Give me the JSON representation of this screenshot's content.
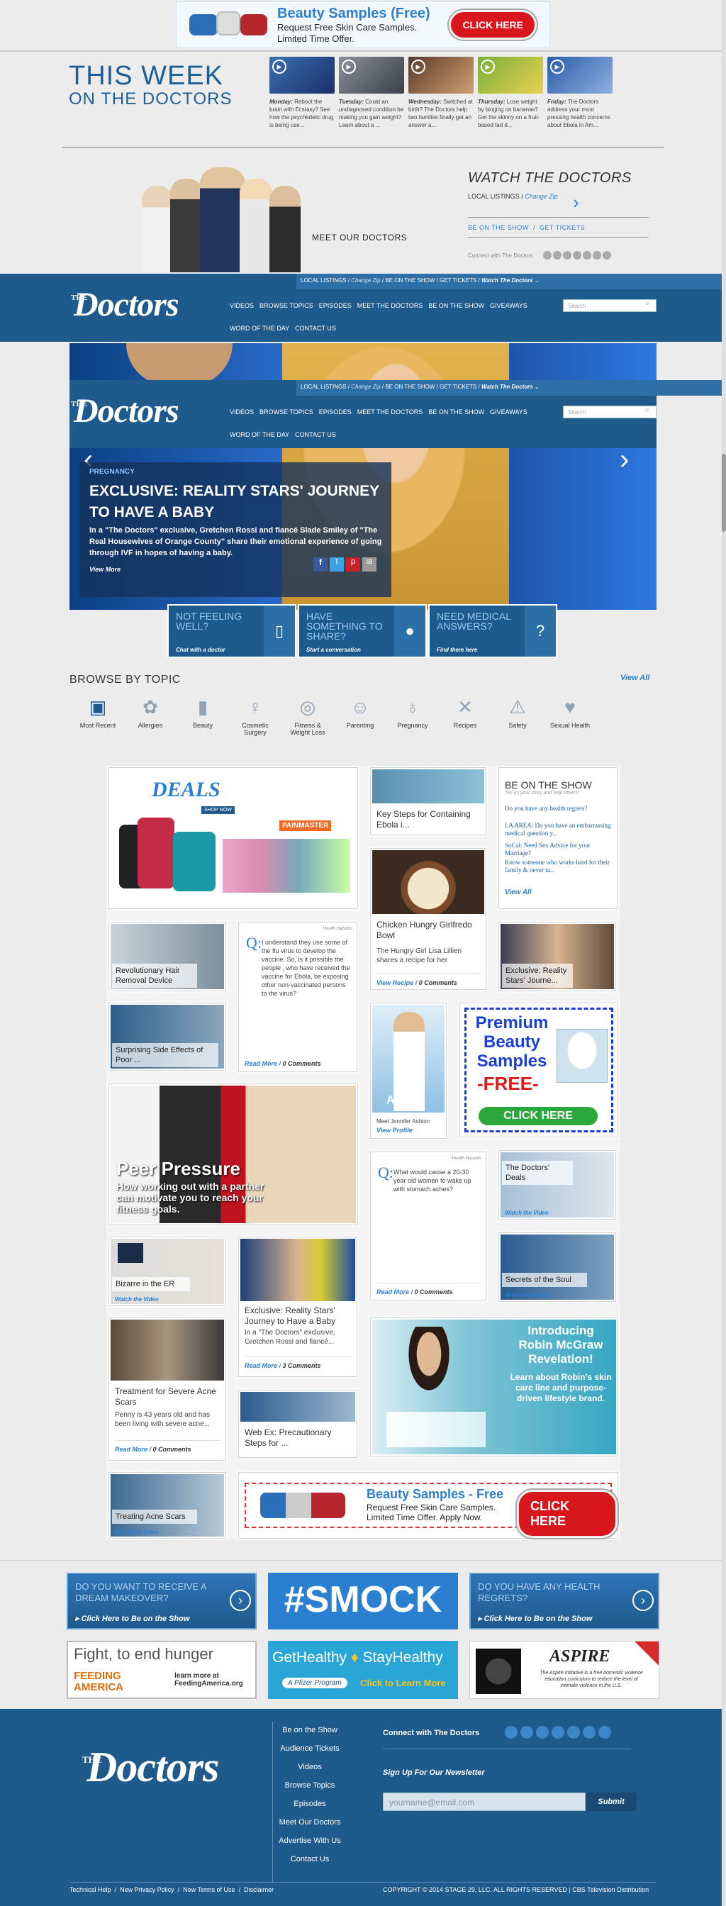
{
  "top_ad": {
    "title": "Beauty Samples (Free)",
    "line1": "Request Free Skin Care Samples.",
    "line2": "Limited Time Offer.",
    "button": "CLICK HERE"
  },
  "this_week": {
    "title_line1": "THIS WEEK",
    "title_line2": "ON THE DOCTORS",
    "episodes": [
      {
        "day": "Monday:",
        "desc": "Reboot the brain with Ecstasy? See how the psychedelic drug is being use..."
      },
      {
        "day": "Tuesday:",
        "desc": "Could an undiagnosed condition be making you gain weight? Learn about a ..."
      },
      {
        "day": "Wednesday:",
        "desc": "Switched at birth? The Doctors help two families finally get an answer a..."
      },
      {
        "day": "Thursday:",
        "desc": "Lose weight by binging on bananas? Get the skinny on a fruit-based fad d..."
      },
      {
        "day": "Friday:",
        "desc": "The Doctors address your most pressing health concerns about Ebola in Am..."
      }
    ]
  },
  "hosts": {
    "meet_label": "MEET OUR DOCTORS"
  },
  "watch": {
    "title": "WATCH THE DOCTORS",
    "local_listings": "LOCAL LISTINGS /",
    "change_zip": "Change Zip",
    "be_on_show": "BE ON THE SHOW",
    "separator": "/",
    "get_tickets": "GET TICKETS",
    "connect": "Connect with The Doctors"
  },
  "nav": {
    "logo_the": "THE",
    "logo_name": "Doctors",
    "local": "LOCAL LISTINGS",
    "change_zip": "Change Zip",
    "be_on": "BE ON THE SHOW",
    "tickets": "GET TICKETS",
    "watch": "Watch The Doctors",
    "links": [
      "VIDEOS",
      "BROWSE TOPICS",
      "EPISODES",
      "MEET THE DOCTORS",
      "BE ON THE SHOW",
      "GIVEAWAYS"
    ],
    "links2": [
      "WORD OF THE DAY",
      "CONTACT US"
    ],
    "search_placeholder": "Search"
  },
  "hero": {
    "tag": "PREGNANCY",
    "title": "EXCLUSIVE: REALITY STARS' JOURNEY TO HAVE A BABY",
    "desc": "In a \"The Doctors\" exclusive, Gretchen Rossi and fiancé Slade Smiley of \"The Real Housewives of Orange County\" share their emotional experience of going through IVF in hopes of having a baby.",
    "more": "View More"
  },
  "pills": [
    {
      "h": "NOT FEELING WELL?",
      "s": "Chat with a doctor"
    },
    {
      "h": "HAVE SOMETHING TO SHARE?",
      "s": "Start a conversation"
    },
    {
      "h": "NEED MEDICAL ANSWERS?",
      "s": "Find them here"
    }
  ],
  "browse": {
    "title": "BROWSE BY TOPIC",
    "view_all": "View All",
    "topics": [
      {
        "l1": "Most Recent",
        "l2": "",
        "icon": "▣"
      },
      {
        "l1": "Allergies",
        "l2": "",
        "icon": "✿"
      },
      {
        "l1": "Beauty",
        "l2": "",
        "icon": "▮"
      },
      {
        "l1": "Cosmetic",
        "l2": "Surgery",
        "icon": "♀"
      },
      {
        "l1": "Fitness &",
        "l2": "Weight Loss",
        "icon": "◎"
      },
      {
        "l1": "Parenting",
        "l2": "",
        "icon": "☺"
      },
      {
        "l1": "Pregnancy",
        "l2": "",
        "icon": "♁"
      },
      {
        "l1": "Recipes",
        "l2": "",
        "icon": "✕"
      },
      {
        "l1": "Safety",
        "l2": "",
        "icon": "⚠"
      },
      {
        "l1": "Sexual Health",
        "l2": "",
        "icon": "♥"
      }
    ]
  },
  "cards": {
    "deals_title": "DEALS",
    "deals_shop": "SHOP NOW",
    "painmaster": "PAINMASTER",
    "ebola": "Key Steps for Containing Ebola i...",
    "bots_title": "BE ON THE SHOW",
    "bots_sub": "Tell us your story and help others!",
    "bots_items": [
      "Do you have any health regrets?",
      "LA AREA: Do you have an embarrassing medical question y...",
      "SoCal: Need Sex Advice for your Marriage?",
      "Know someone who works hard for their family & never ta..."
    ],
    "bots_viewall": "View All",
    "hair": "Revolutionary Hair Removal Device",
    "q1_label": "Health Hazards",
    "q1": "I understand they use some of the flu virus to develop the vaccine. So, is it possible the people , who have received the vaccine for Ebola, be exposing other non-vaccinated persons to the virus?",
    "read_more": "Read More",
    "zero_comments": "0 Comments",
    "chicken_title": "Chicken Hungry Girlfredo Bowl",
    "chicken_desc": "The Hungry Girl Lisa Lillien shares a recipe for her",
    "view_recipe": "View Recipe",
    "reality_small": "Exclusive: Reality Stars' Journe...",
    "side_effects": "Surprising Side Effects of Poor ...",
    "ashton_caption": "Meet Jennifer Ashton",
    "view_profile": "View Profile",
    "ashton_name": "Ashton",
    "premium": [
      "Premium",
      "Beauty",
      "Samples"
    ],
    "premium_free": "-FREE-",
    "premium_click": "CLICK HERE",
    "peer_title": "Peer Pressure",
    "peer_sub": "How working out with a partner can motivate you to reach your fitness goals.",
    "q2_label": "Health Hazards",
    "q2": "What would cause a 20-30 year old women to wake up with stomach aches?",
    "deals_video": "The Doctors' Deals",
    "watch_video": "Watch the Video",
    "er": "Bizarre in the ER",
    "reality_title": "Exclusive: Reality Stars' Journey to Have a Baby",
    "reality_desc": "In a \"The Doctors\" exclusive, Gretchen Rossi and fiancé...",
    "three_comments": "3 Comments",
    "soul": "Secrets of the Soul",
    "acne_title": "Treatment for Severe Acne Scars",
    "acne_desc": "Penny is 43 years old and has been living with severe acne...",
    "robin": [
      "Introducing",
      "Robin McGraw",
      "Revelation!"
    ],
    "robin_sub": "Learn about Robin's skin care line and purpose-driven lifestyle brand.",
    "webex": "Web Ex: Precautionary Steps for ...",
    "treating_acne": "Treating Acne Scars",
    "ad2_title": "Beauty Samples - Free",
    "ad2_l1": "Request Free Skin Care Samples.",
    "ad2_l2": "Limited Time Offer. Apply Now.",
    "ad2_button": "CLICK HERE"
  },
  "promos": {
    "p1": "DO YOU WANT TO RECEIVE A DREAM MAKEOVER?",
    "p1_link": "Click Here to Be on the Show",
    "smock": "#SMOCK",
    "p3": "DO YOU HAVE ANY HEALTH REGRETS?",
    "p3_link": "Click Here to Be on the Show",
    "fight": "Fight, to end hunger",
    "feeding": "FEEDING AMERICA",
    "feeding_more": "learn more at FeedingAmerica.org",
    "gh1": "GetHealthy",
    "gh2": "StayHealthy",
    "gh3": "A Pfizer Program",
    "gh4": "Click to Learn More",
    "aspire": "ASPIRE",
    "aspire_desc": "The Aspire Initiative is a free domestic violence education curriculum to reduce the level of intimate violence in the U.S."
  },
  "footer": {
    "links": [
      "Be on the Show",
      "Audience Tickets",
      "Videos",
      "Browse Topics",
      "Episodes",
      "Meet Our Doctors",
      "Advertise With Us",
      "Contact Us"
    ],
    "connect": "Connect with The Doctors",
    "newsletter": "Sign Up For Our Newsletter",
    "email_placeholder": "yourname@email.com",
    "submit": "Submit",
    "bottom_links": [
      "Technical Help",
      "New Privacy Policy",
      "New Terms of Use",
      "Disclaimer"
    ],
    "separator": "/",
    "copyright": "COPYRIGHT © 2014 STAGE 29, LLC. ALL RIGHTS RESERVED | CBS Television Distribution"
  },
  "colors": {
    "brand": "#1f5a8c",
    "accent": "#2a7fd0",
    "ad_red": "#d8161c"
  }
}
